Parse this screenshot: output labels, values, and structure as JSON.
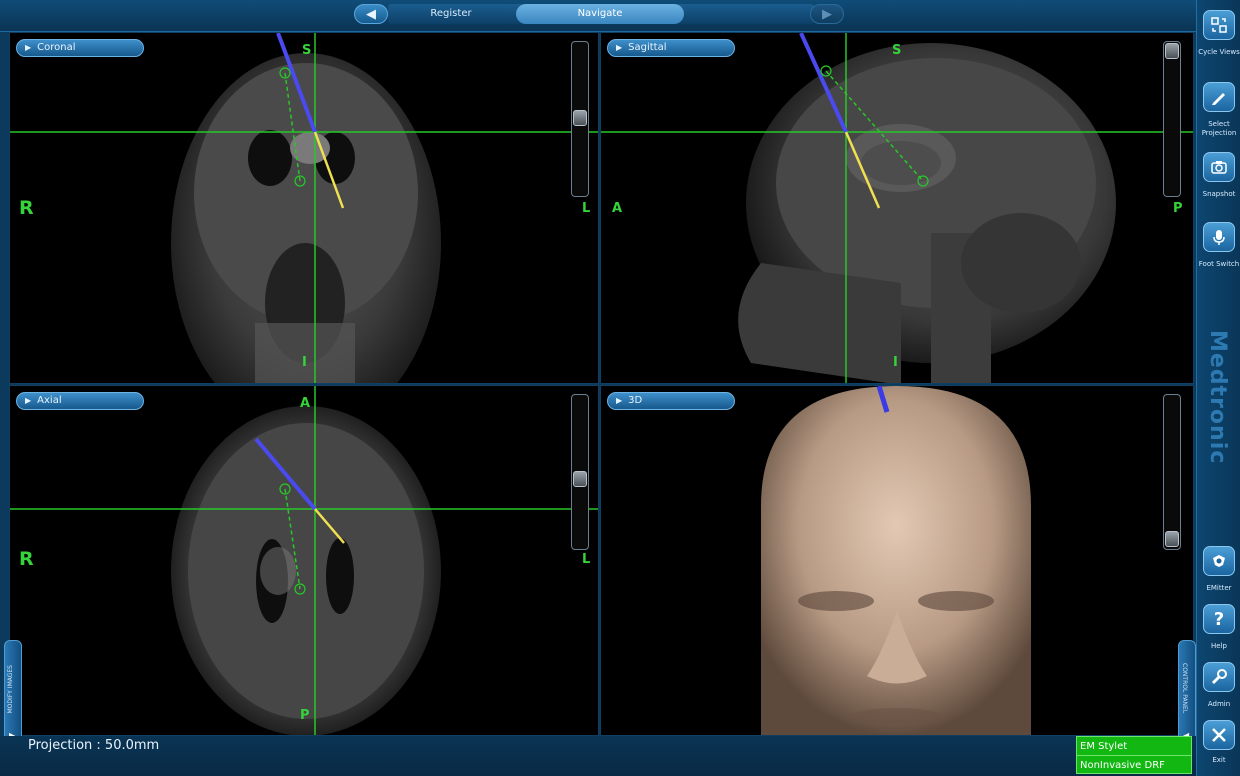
{
  "nav": {
    "tabs": [
      {
        "label": "Register"
      },
      {
        "label": "Navigate"
      }
    ]
  },
  "viewports": {
    "coronal": {
      "label": "Coronal",
      "top": "S",
      "bottom": "I",
      "left": "R",
      "right": "L"
    },
    "sagittal": {
      "label": "Sagittal",
      "top": "S",
      "bottom": "I",
      "left": "A",
      "right": "P"
    },
    "axial": {
      "label": "Axial",
      "top": "A",
      "bottom": "P",
      "left": "R",
      "right": "L"
    },
    "three_d": {
      "label": "3D"
    }
  },
  "right_panel": {
    "buttons": [
      {
        "label": "Cycle Views",
        "icon": "cycle-views-icon"
      },
      {
        "label": "Select Projection",
        "icon": "pen-icon"
      },
      {
        "label": "Snapshot",
        "icon": "camera-icon"
      },
      {
        "label": "Foot Switch",
        "icon": "microphone-icon"
      },
      {
        "label": "EMitter",
        "icon": "emitter-icon"
      },
      {
        "label": "Help",
        "icon": "help-icon"
      },
      {
        "label": "Admin",
        "icon": "wrench-icon"
      },
      {
        "label": "Exit",
        "icon": "close-icon"
      }
    ],
    "brand": "Medtronic"
  },
  "side_tabs": {
    "left": "MODIFY IMAGES",
    "right": "CONTROL PANEL"
  },
  "status": {
    "projection": "Projection : 50.0mm",
    "instrument": "EM Stylet",
    "reference": "NonInvasive DRF"
  },
  "colors": {
    "accent": "#2f7fbf",
    "crosshair": "#28c828",
    "status_ok": "#12b712"
  }
}
